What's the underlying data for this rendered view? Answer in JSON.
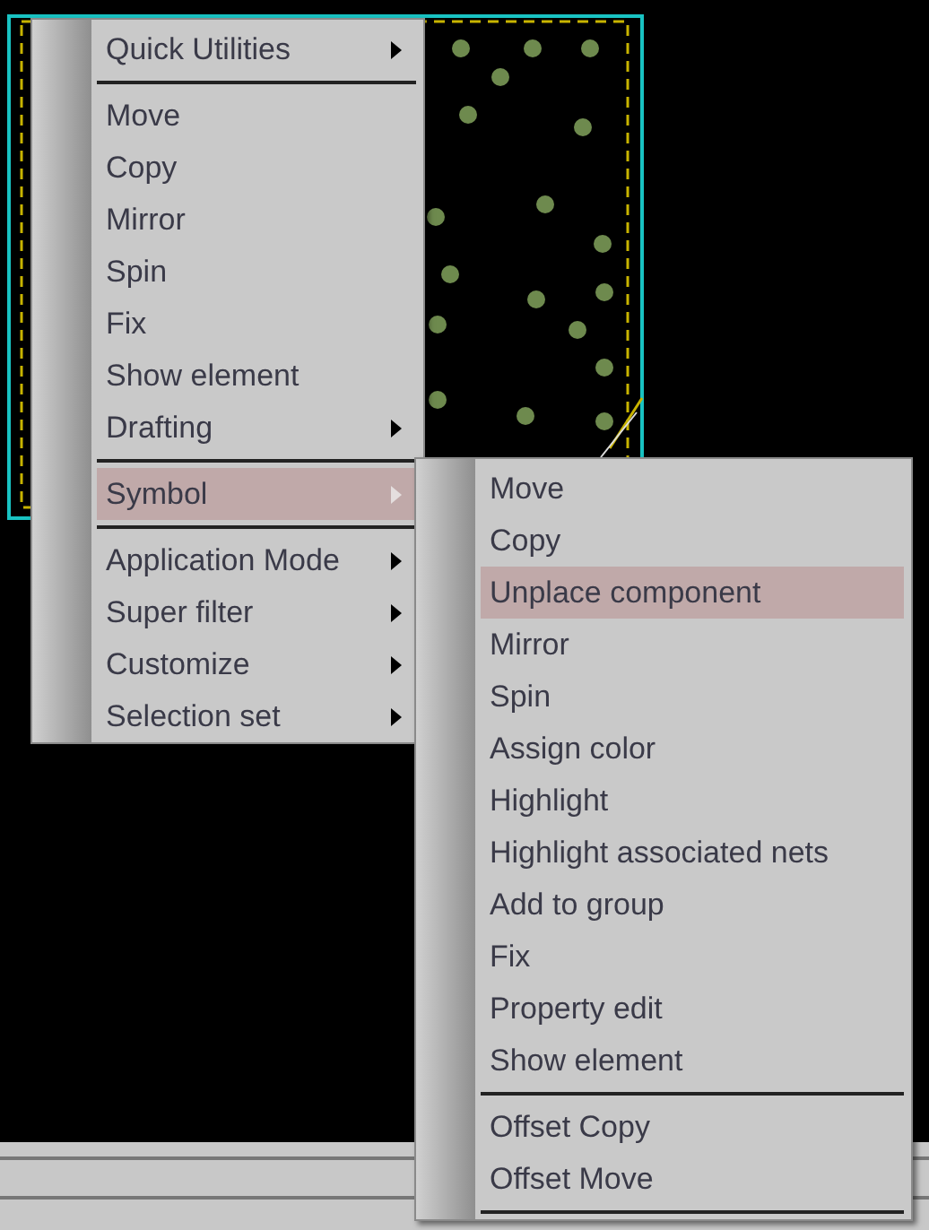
{
  "context_menu": {
    "items": [
      {
        "kind": "item",
        "label": "Quick Utilities",
        "submenu": true,
        "selected": false
      },
      {
        "kind": "separator"
      },
      {
        "kind": "item",
        "label": "Move",
        "submenu": false,
        "selected": false
      },
      {
        "kind": "item",
        "label": "Copy",
        "submenu": false,
        "selected": false
      },
      {
        "kind": "item",
        "label": "Mirror",
        "submenu": false,
        "selected": false
      },
      {
        "kind": "item",
        "label": "Spin",
        "submenu": false,
        "selected": false
      },
      {
        "kind": "item",
        "label": "Fix",
        "submenu": false,
        "selected": false
      },
      {
        "kind": "item",
        "label": "Show element",
        "submenu": false,
        "selected": false
      },
      {
        "kind": "item",
        "label": "Drafting",
        "submenu": true,
        "selected": false
      },
      {
        "kind": "separator"
      },
      {
        "kind": "item",
        "label": "Symbol",
        "submenu": true,
        "selected": true
      },
      {
        "kind": "separator"
      },
      {
        "kind": "item",
        "label": "Application Mode",
        "submenu": true,
        "selected": false
      },
      {
        "kind": "item",
        "label": "Super filter",
        "submenu": true,
        "selected": false
      },
      {
        "kind": "item",
        "label": "Customize",
        "submenu": true,
        "selected": false
      },
      {
        "kind": "item",
        "label": "Selection set",
        "submenu": true,
        "selected": false
      }
    ]
  },
  "submenu": {
    "items": [
      {
        "kind": "item",
        "label": "Move",
        "selected": false
      },
      {
        "kind": "item",
        "label": "Copy",
        "selected": false
      },
      {
        "kind": "item",
        "label": "Unplace component",
        "selected": true
      },
      {
        "kind": "item",
        "label": "Mirror",
        "selected": false
      },
      {
        "kind": "item",
        "label": "Spin",
        "selected": false
      },
      {
        "kind": "item",
        "label": "Assign color",
        "selected": false
      },
      {
        "kind": "item",
        "label": "Highlight",
        "selected": false
      },
      {
        "kind": "item",
        "label": "Highlight associated nets",
        "selected": false
      },
      {
        "kind": "item",
        "label": "Add to group",
        "selected": false
      },
      {
        "kind": "item",
        "label": "Fix",
        "selected": false
      },
      {
        "kind": "item",
        "label": "Property edit",
        "selected": false
      },
      {
        "kind": "item",
        "label": "Show element",
        "selected": false
      },
      {
        "kind": "separator"
      },
      {
        "kind": "item",
        "label": "Offset Copy",
        "selected": false
      },
      {
        "kind": "item",
        "label": "Offset Move",
        "selected": false
      },
      {
        "kind": "separator"
      }
    ]
  }
}
